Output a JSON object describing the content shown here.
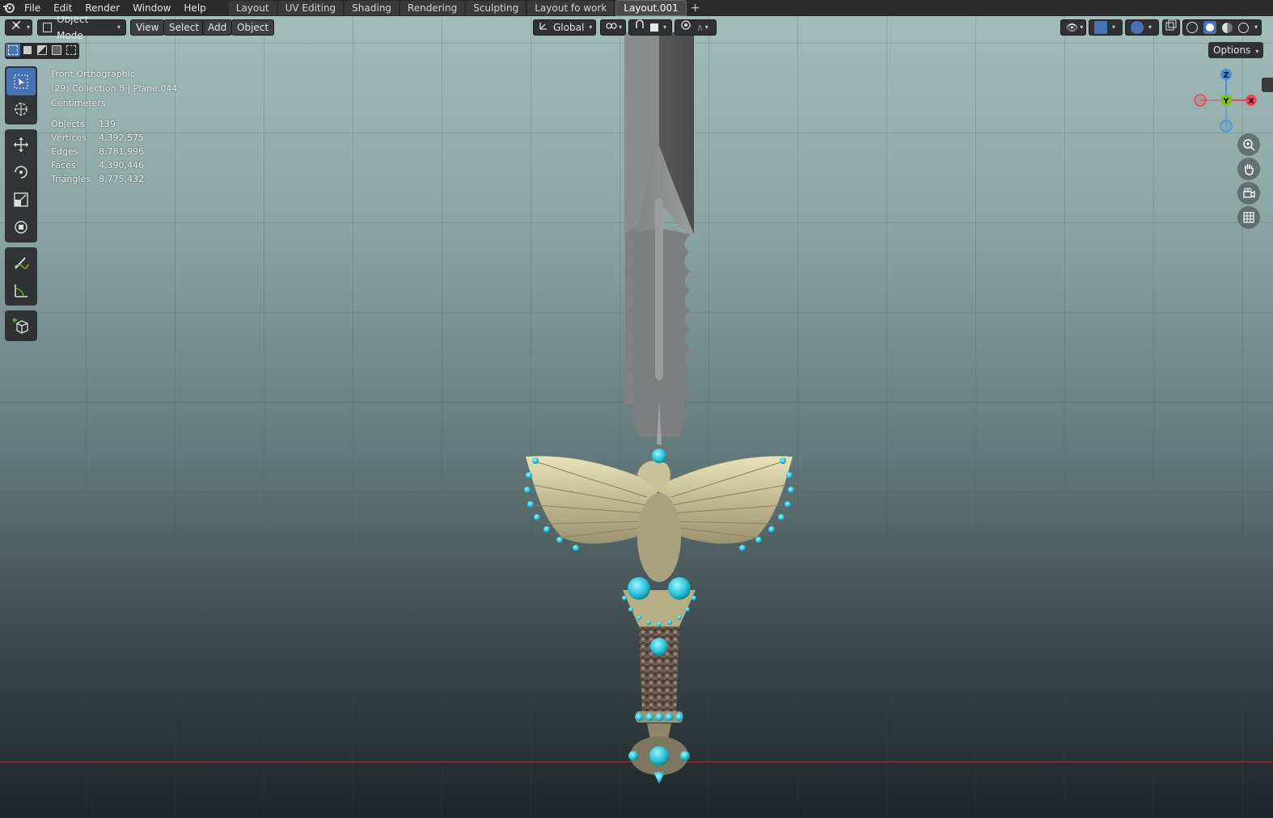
{
  "menu": [
    "File",
    "Edit",
    "Render",
    "Window",
    "Help"
  ],
  "workspaces": [
    {
      "label": "Layout",
      "active": false
    },
    {
      "label": "UV Editing",
      "active": false
    },
    {
      "label": "Shading",
      "active": false
    },
    {
      "label": "Rendering",
      "active": false
    },
    {
      "label": "Sculpting",
      "active": false
    },
    {
      "label": "Layout fo work",
      "active": false
    },
    {
      "label": "Layout.001",
      "active": true
    }
  ],
  "add_tab_label": "+",
  "header": {
    "mode": "Object Mode",
    "view": "View",
    "select": "Select",
    "add": "Add",
    "object": "Object",
    "orientation": "Global",
    "options": "Options"
  },
  "overlay": {
    "view_name": "Front Orthographic",
    "collection": "(29) Collection 8 | Plane.044",
    "units": "Centimeters"
  },
  "stats": [
    {
      "label": "Objects",
      "value": "139"
    },
    {
      "label": "Vertices",
      "value": "4,392,575"
    },
    {
      "label": "Edges",
      "value": "8,781,996"
    },
    {
      "label": "Faces",
      "value": "4,390,446"
    },
    {
      "label": "Triangles",
      "value": "8,775,432"
    }
  ],
  "gizmo": {
    "z": "Z",
    "y": "Y",
    "x": "X"
  },
  "colors": {
    "accent": "#4772b3",
    "axis_x": "#e8485c",
    "axis_y": "#7ec21c",
    "axis_z": "#4b8fe0",
    "gem": "#2bc3d6"
  }
}
